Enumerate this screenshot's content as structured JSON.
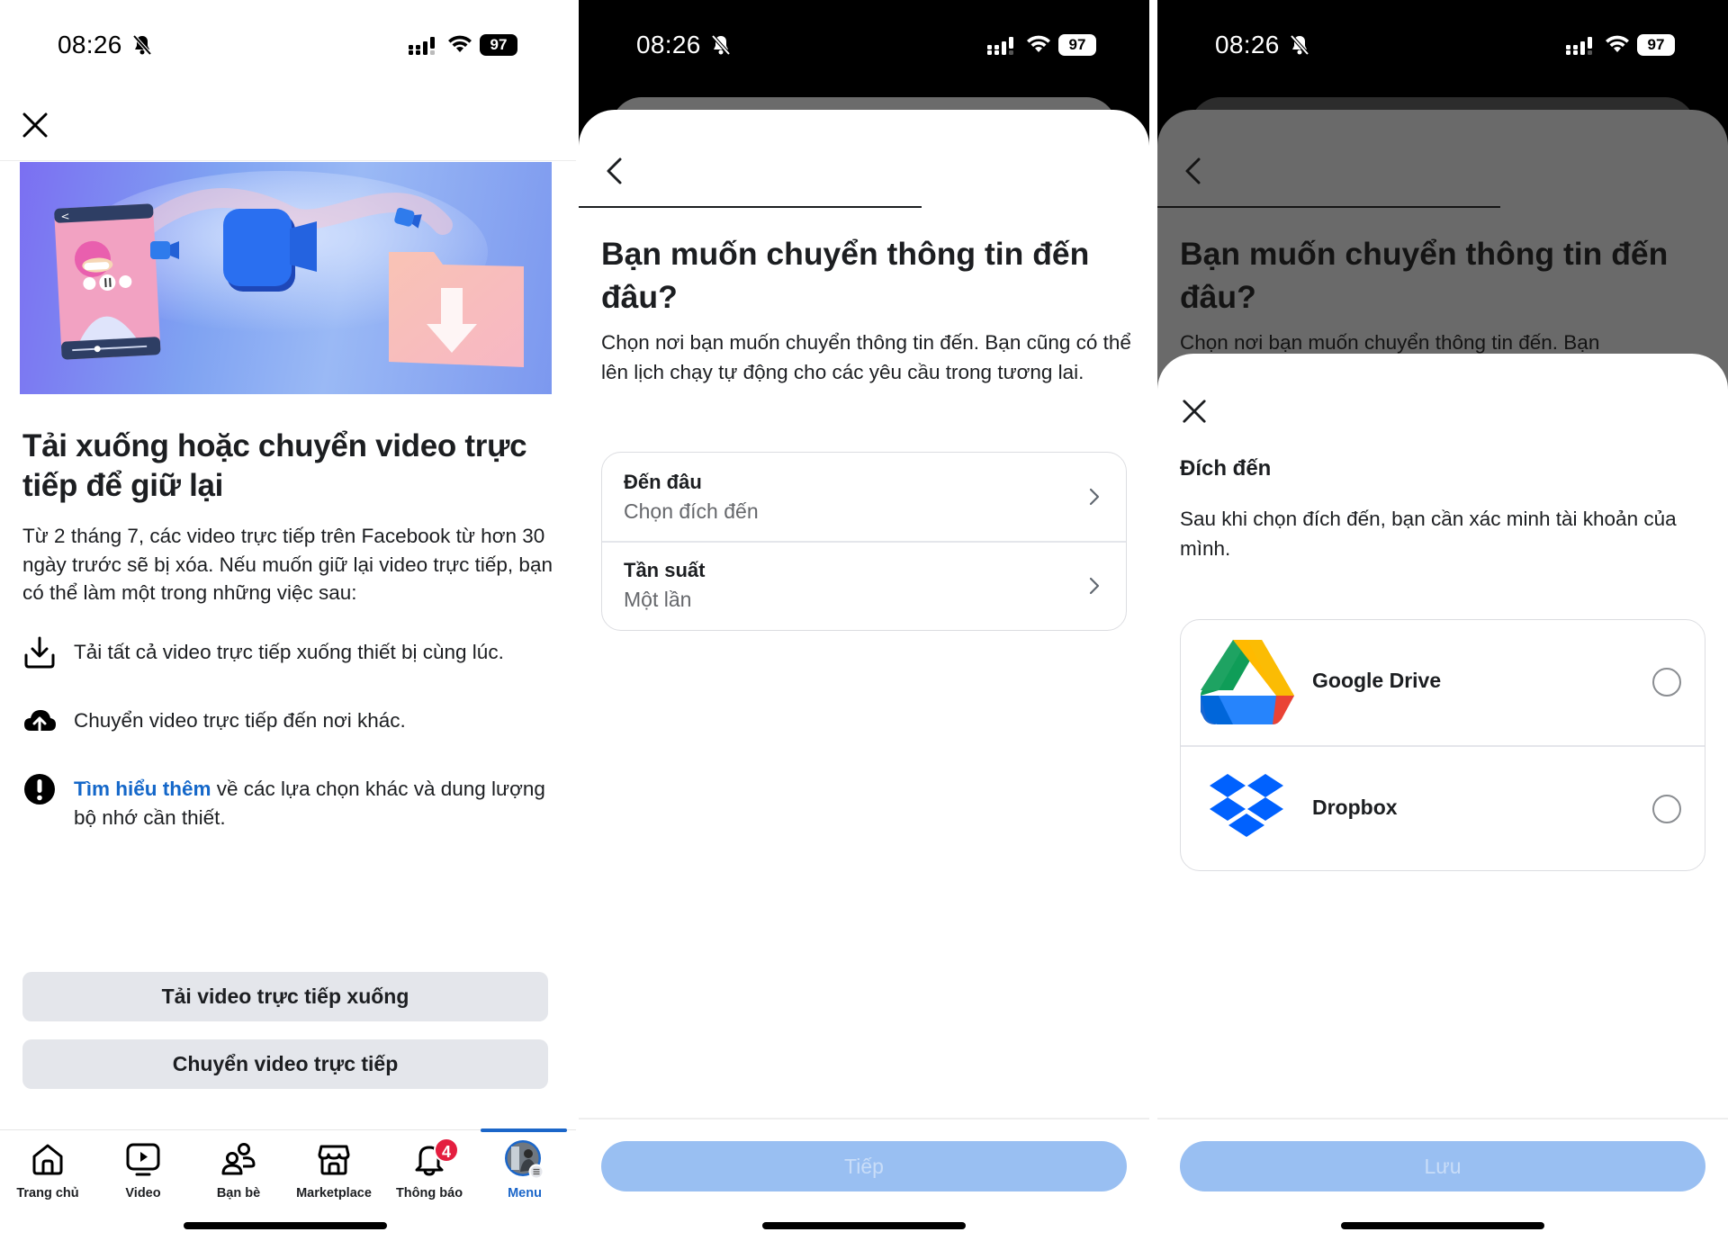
{
  "status_bar": {
    "time": "08:26",
    "battery": "97",
    "icons": [
      "bell-slash-icon",
      "signal-icon",
      "wifi-icon",
      "battery-icon"
    ]
  },
  "screen1": {
    "close_icon": "close-icon",
    "banner": "live-video-download-illustration",
    "title": "Tải xuống hoặc chuyển video trực tiếp để giữ lại",
    "body": "Từ 2 tháng 7, các video trực tiếp trên Facebook từ hơn 30 ngày trước sẽ bị xóa. Nếu muốn giữ lại video trực tiếp, bạn có thể làm một trong những việc sau:",
    "options": [
      {
        "icon": "download-icon",
        "text": "Tải tất cả video trực tiếp xuống thiết bị cùng lúc."
      },
      {
        "icon": "cloud-upload-icon",
        "text": "Chuyển video trực tiếp đến nơi khác."
      },
      {
        "icon": "alert-icon",
        "link": "Tìm hiểu thêm",
        "text": " về các lựa chọn khác và dung lượng bộ nhớ cần thiết."
      }
    ],
    "buttons": {
      "download": "Tải video trực tiếp xuống",
      "transfer": "Chuyển video trực tiếp"
    },
    "tabs": [
      {
        "label": "Trang chủ",
        "icon": "home-icon",
        "active": false
      },
      {
        "label": "Video",
        "icon": "video-icon",
        "active": false
      },
      {
        "label": "Bạn bè",
        "icon": "friends-icon",
        "active": false
      },
      {
        "label": "Marketplace",
        "icon": "marketplace-icon",
        "active": false
      },
      {
        "label": "Thông báo",
        "icon": "bell-icon",
        "active": false,
        "badge": "4"
      },
      {
        "label": "Menu",
        "icon": "avatar",
        "active": true
      }
    ],
    "accent": "#1b66c9",
    "badge_color": "#e41e3f"
  },
  "screen2": {
    "back_icon": "chevron-left-icon",
    "progress": 0.5,
    "title": "Bạn muốn chuyển thông tin đến đâu?",
    "description": "Chọn nơi bạn muốn chuyển thông tin đến. Bạn cũng có thể lên lịch chạy tự động cho các yêu cầu trong tương lai.",
    "rows": [
      {
        "label": "Đến đâu",
        "value": "Chọn đích đến"
      },
      {
        "label": "Tần suất",
        "value": "Một lần"
      }
    ],
    "next_button": "Tiếp",
    "next_enabled": false,
    "button_color": "#99bff2"
  },
  "screen3": {
    "background_title": "Bạn muốn chuyển thông tin đến đâu?",
    "background_description": "Chọn nơi bạn muốn chuyển thông tin đến. Bạn",
    "sheet_title": "Đích đến",
    "sheet_description": "Sau khi chọn đích đến, bạn cần xác minh tài khoản của mình.",
    "destinations": [
      {
        "name": "Google Drive",
        "icon": "google-drive-icon",
        "selected": false
      },
      {
        "name": "Dropbox",
        "icon": "dropbox-icon",
        "selected": false
      }
    ],
    "save_button": "Lưu",
    "save_enabled": false
  }
}
